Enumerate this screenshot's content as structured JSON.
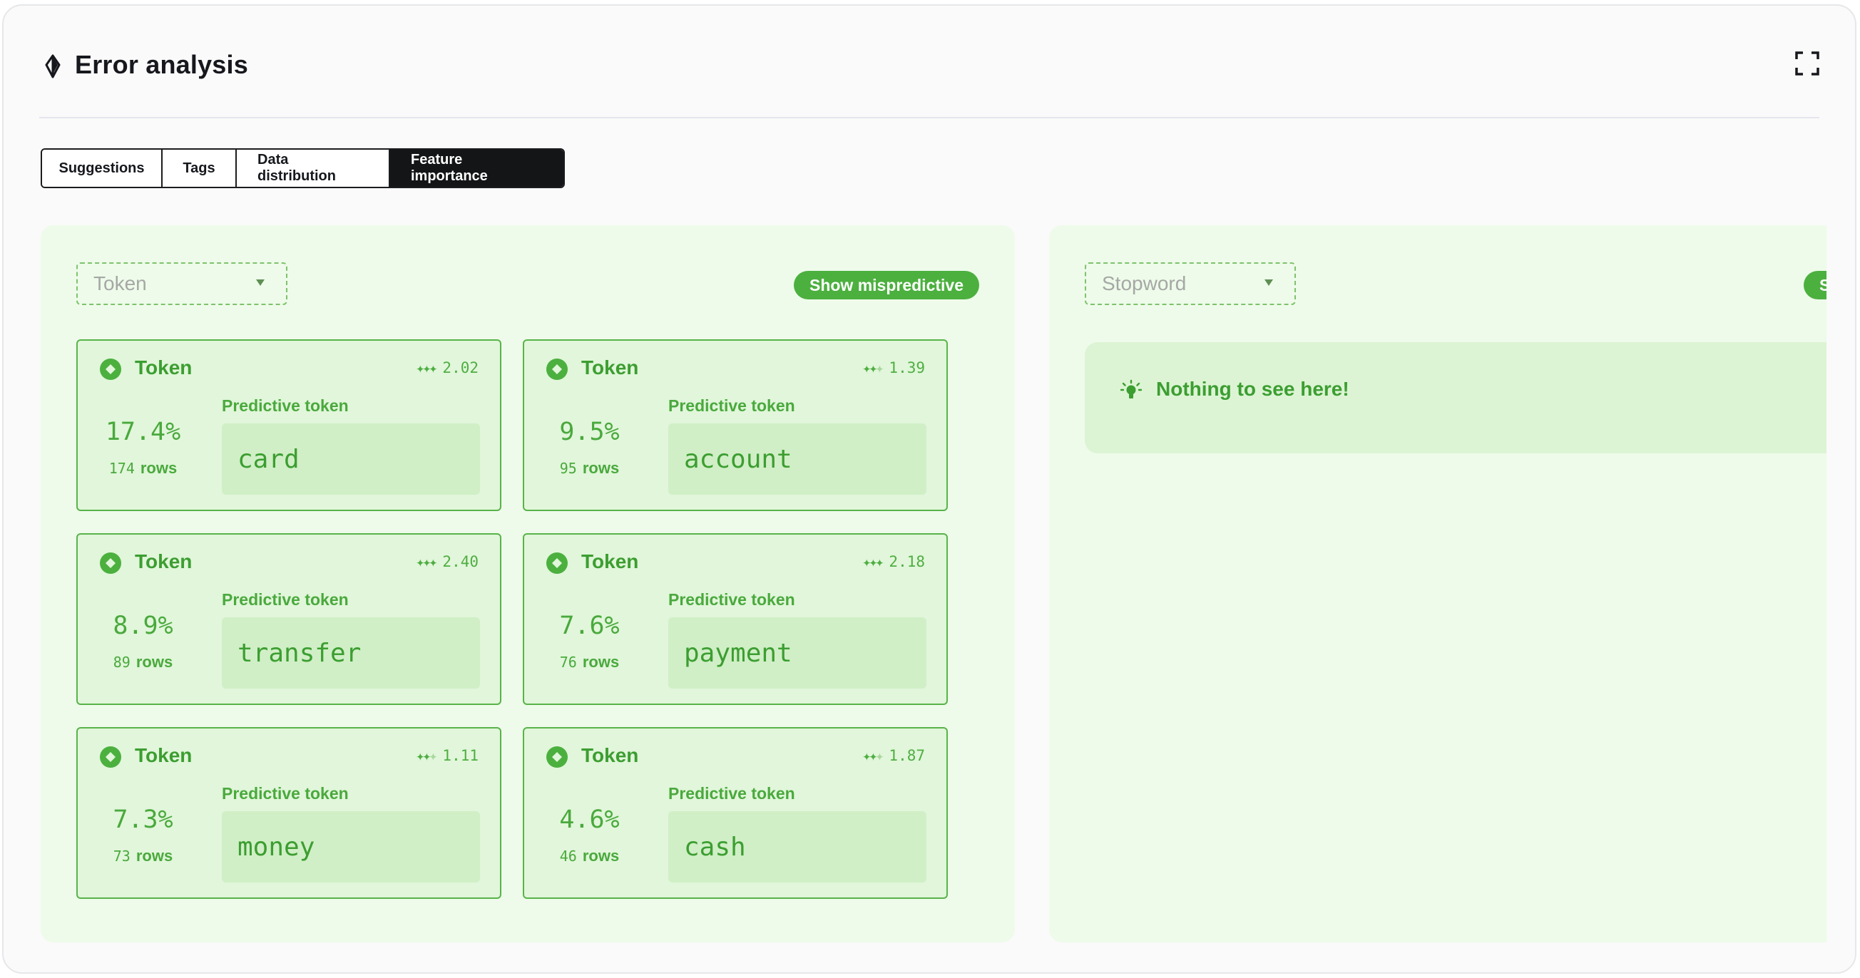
{
  "header": {
    "title": "Error analysis",
    "title_icon": "diamond-pin-icon",
    "expand_icon": "fullscreen-icon"
  },
  "tabs": [
    {
      "label": "Suggestions",
      "active": false
    },
    {
      "label": "Tags",
      "active": false
    },
    {
      "label": "Data distribution",
      "active": false
    },
    {
      "label": "Feature importance",
      "active": true
    }
  ],
  "colors": {
    "accent": "#4cb03f",
    "panel_bg": "#eefbea",
    "card_bg": "#e1f6da",
    "tab_active_bg": "#141517"
  },
  "left_panel": {
    "dropdown_value": "Token",
    "toggle_label": "Show mispredictive",
    "cards": [
      {
        "type": "Token",
        "score": "2.02",
        "strength": 3,
        "sublabel": "Predictive token",
        "percent": "17.4%",
        "rows": "174",
        "rows_label": "rows",
        "token": "card"
      },
      {
        "type": "Token",
        "score": "1.39",
        "strength": 2,
        "sublabel": "Predictive token",
        "percent": "9.5%",
        "rows": "95",
        "rows_label": "rows",
        "token": "account"
      },
      {
        "type": "Token",
        "score": "2.40",
        "strength": 3,
        "sublabel": "Predictive token",
        "percent": "8.9%",
        "rows": "89",
        "rows_label": "rows",
        "token": "transfer"
      },
      {
        "type": "Token",
        "score": "2.18",
        "strength": 3,
        "sublabel": "Predictive token",
        "percent": "7.6%",
        "rows": "76",
        "rows_label": "rows",
        "token": "payment"
      },
      {
        "type": "Token",
        "score": "1.11",
        "strength": 2,
        "sublabel": "Predictive token",
        "percent": "7.3%",
        "rows": "73",
        "rows_label": "rows",
        "token": "money"
      },
      {
        "type": "Token",
        "score": "1.87",
        "strength": 2,
        "sublabel": "Predictive token",
        "percent": "4.6%",
        "rows": "46",
        "rows_label": "rows",
        "token": "cash"
      }
    ]
  },
  "right_panel": {
    "dropdown_value": "Stopword",
    "toggle_label": "Show mispredictive",
    "empty_message": "Nothing to see here!",
    "empty_icon": "lightbulb-icon"
  }
}
